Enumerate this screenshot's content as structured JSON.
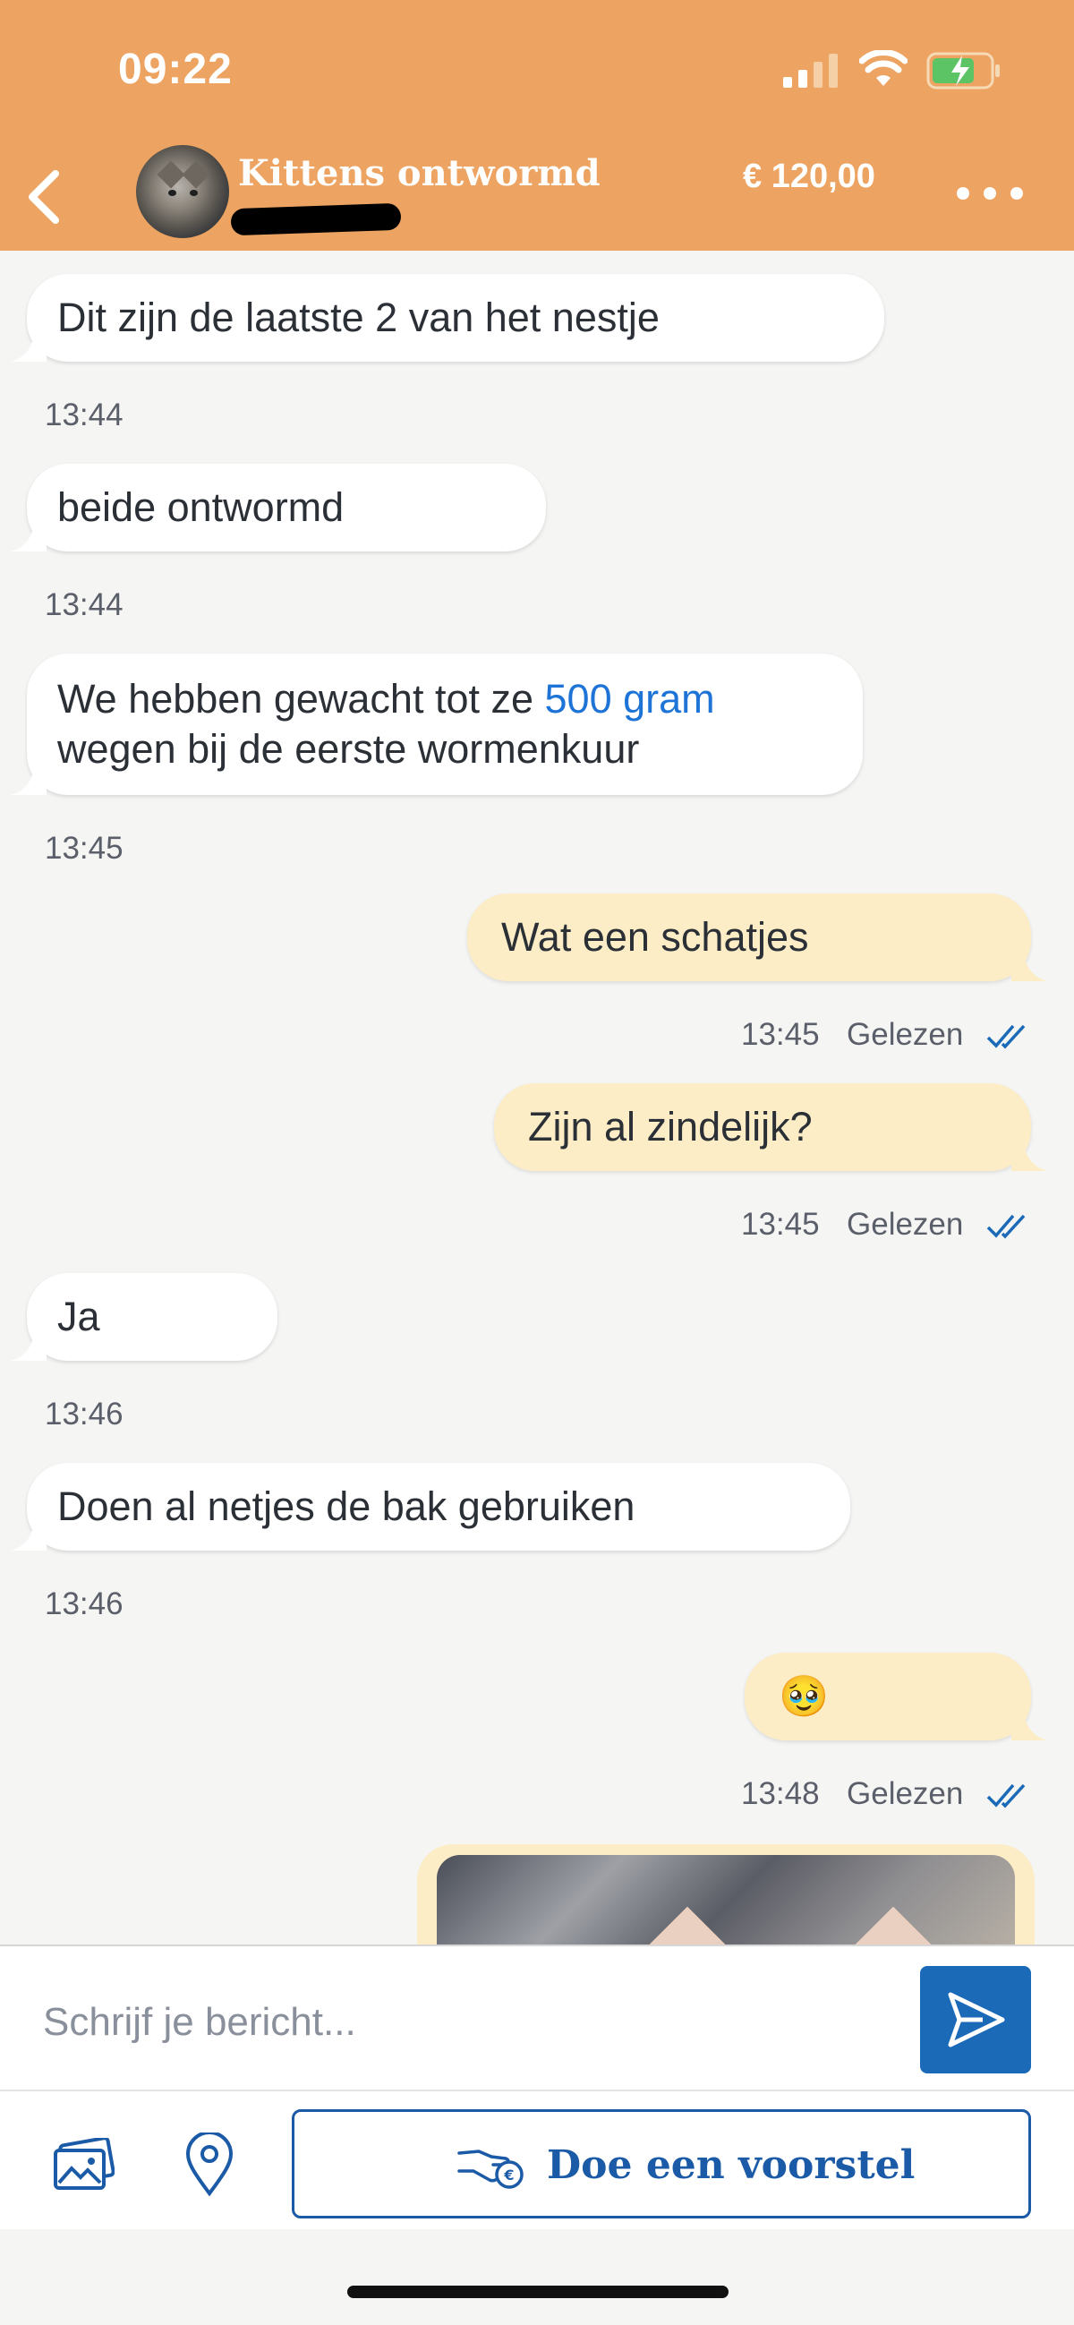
{
  "status": {
    "time": "09:22"
  },
  "header": {
    "title": "Kittens ontwormd",
    "price": "€ 120,00"
  },
  "messages": [
    {
      "dir": "in",
      "text": "Dit zijn de laatste 2 van het nestje",
      "time": "13:44"
    },
    {
      "dir": "in",
      "text": "beide ontwormd",
      "time": "13:44"
    },
    {
      "dir": "in",
      "text_before": "We hebben gewacht tot ze ",
      "link": "500 gram",
      "text_after": "wegen bij de eerste wormenkuur",
      "time": "13:45"
    },
    {
      "dir": "out",
      "text": "Wat een schatjes",
      "time": "13:45",
      "status": "Gelezen"
    },
    {
      "dir": "out",
      "text": "Zijn al zindelijk?",
      "time": "13:45",
      "status": "Gelezen"
    },
    {
      "dir": "in",
      "text": "Ja",
      "time": "13:46"
    },
    {
      "dir": "in",
      "text": "Doen al netjes de bak gebruiken",
      "time": "13:46"
    },
    {
      "dir": "out",
      "text": "🥹",
      "time": "13:48",
      "status": "Gelezen"
    }
  ],
  "composer": {
    "placeholder": "Schrijf je bericht..."
  },
  "toolbar": {
    "offer_label": "Doe een voorstel"
  },
  "colors": {
    "header": "#eda462",
    "outgoing": "#fcedc6",
    "incoming": "#ffffff",
    "accent": "#1b6ab8",
    "link": "#1d73d6"
  },
  "icons": [
    "back-icon",
    "more-icon",
    "signal-icon",
    "wifi-icon",
    "battery-icon",
    "send-icon",
    "photo-icon",
    "location-icon",
    "offer-hand-icon",
    "read-ticks-icon"
  ]
}
